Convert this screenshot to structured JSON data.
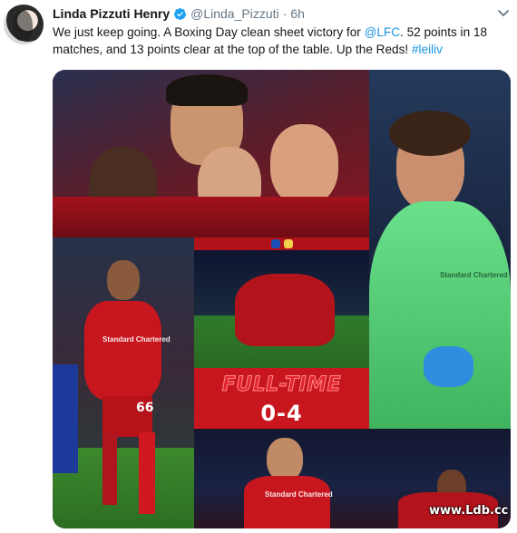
{
  "tweet": {
    "display_name": "Linda Pizzuti Henry",
    "handle": "@Linda_Pizzuti",
    "separator": "·",
    "time": "6h",
    "text_segments": [
      {
        "text": "We just keep going. A Boxing Day clean sheet victory for ",
        "link": false
      },
      {
        "text": "@LFC",
        "link": true
      },
      {
        "text": ".  52 points in 18 matches, and 13 points clear at the top of the table. Up the Reds! ",
        "link": false
      },
      {
        "text": "#leiliv",
        "link": true
      }
    ]
  },
  "media": {
    "result_banner": "FULL-TIME",
    "score": "0-4",
    "sponsor_text_1": "Standard Chartered",
    "sponsor_text_2": "Standard Chartered",
    "sponsor_text_3": "Standard Chartered",
    "shirt_number": "66",
    "watermark": "www.Ldb.cc"
  },
  "colors": {
    "link": "#1b95e0",
    "muted": "#657786",
    "verified": "#1da1f2",
    "lfc_red": "#c8161e",
    "keeper_green": "#5fd07a"
  },
  "icons": {
    "verified": "verified-badge-icon",
    "more": "chevron-down-icon"
  }
}
